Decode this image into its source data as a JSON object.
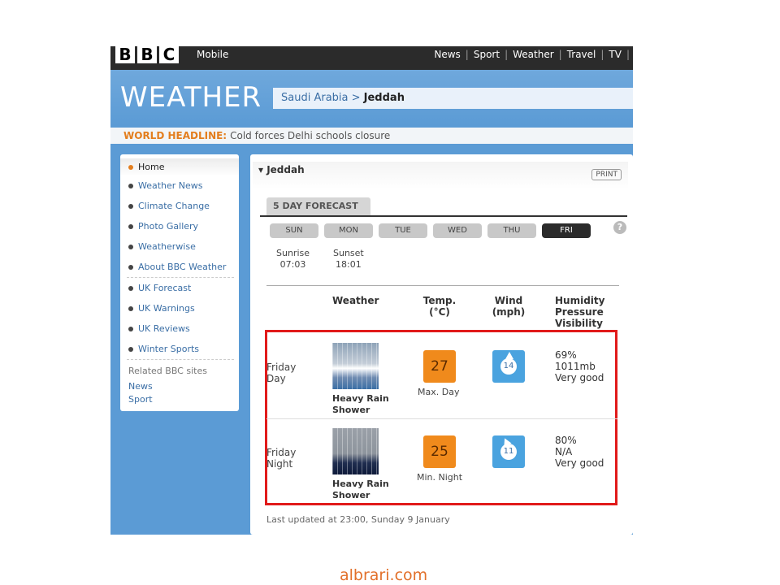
{
  "topbar": {
    "logo_letters": [
      "B",
      "B",
      "C"
    ],
    "mobile": "Mobile",
    "nav": [
      "News",
      "Sport",
      "Weather",
      "Travel",
      "TV"
    ]
  },
  "header": {
    "title": "WEATHER",
    "breadcrumb_country": "Saudi Arabia >",
    "breadcrumb_city": "Jeddah"
  },
  "headline": {
    "label": "WORLD HEADLINE:",
    "text": "Cold forces Delhi schools closure"
  },
  "leftnav": {
    "items": [
      "Home",
      "Weather News",
      "Climate Change",
      "Photo Gallery",
      "Weatherwise",
      "About BBC Weather"
    ],
    "uk_items": [
      "UK Forecast",
      "UK Warnings",
      "UK Reviews",
      "Winter Sports"
    ],
    "related_label": "Related BBC sites",
    "related_links": [
      "News",
      "Sport"
    ]
  },
  "panel": {
    "title": "▾ Jeddah",
    "print": "PRINT",
    "tab": "5 DAY FORECAST",
    "help": "?",
    "days": [
      "SUN",
      "MON",
      "TUE",
      "WED",
      "THU",
      "FRI"
    ],
    "active_day": "FRI",
    "sunrise_label": "Sunrise",
    "sunrise_time": "07:03",
    "sunset_label": "Sunset",
    "sunset_time": "18:01"
  },
  "columns": {
    "weather": "Weather",
    "temp_1": "Temp.",
    "temp_2": "(°C)",
    "wind_1": "Wind",
    "wind_2": "(mph)",
    "stats_1": "Humidity",
    "stats_2": "Pressure",
    "stats_3": "Visibility"
  },
  "rows": [
    {
      "period_1": "Friday",
      "period_2": "Day",
      "weather_1": "Heavy Rain",
      "weather_2": "Shower",
      "temp": "27",
      "temp_caption": "Max. Day",
      "wind": "14",
      "humidity": "69%",
      "pressure": "1011mb",
      "visibility": "Very good"
    },
    {
      "period_1": "Friday",
      "period_2": "Night",
      "weather_1": "Heavy Rain",
      "weather_2": "Shower",
      "temp": "25",
      "temp_caption": "Min. Night",
      "wind": "11",
      "humidity": "80%",
      "pressure": "N/A",
      "visibility": "Very good"
    }
  ],
  "updated": "Last updated at 23:00, Sunday 9 January",
  "watermark": "albrari.com",
  "colors": {
    "accent_orange": "#e37e1e",
    "highlight_red": "#e11a1a",
    "wind_blue": "#4aa3df",
    "temp_orange": "#f08a1c"
  }
}
